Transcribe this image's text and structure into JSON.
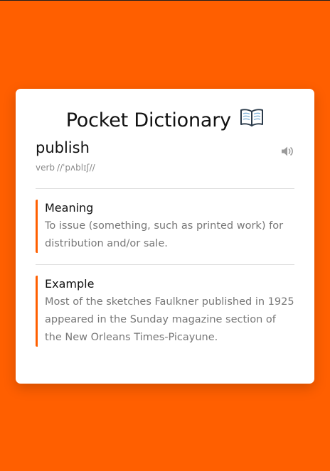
{
  "app": {
    "title": "Pocket Dictionary",
    "title_icon": "open-book-icon"
  },
  "entry": {
    "word": "publish",
    "part_of_speech": "verb",
    "phonetic": "//ˈpʌblɪʃ//",
    "speaker_icon": "speaker-icon"
  },
  "meaning": {
    "heading": "Meaning",
    "text": "To issue (something, such as printed work) for distribution and/or sale."
  },
  "example": {
    "heading": "Example",
    "text": "Most of the sketches Faulkner published in 1925 appeared in the Sunday magazine section of the New Orleans Times-Picayune."
  },
  "colors": {
    "accent": "#FF5F00",
    "card": "#FFFFFF",
    "muted_text": "#777777"
  }
}
